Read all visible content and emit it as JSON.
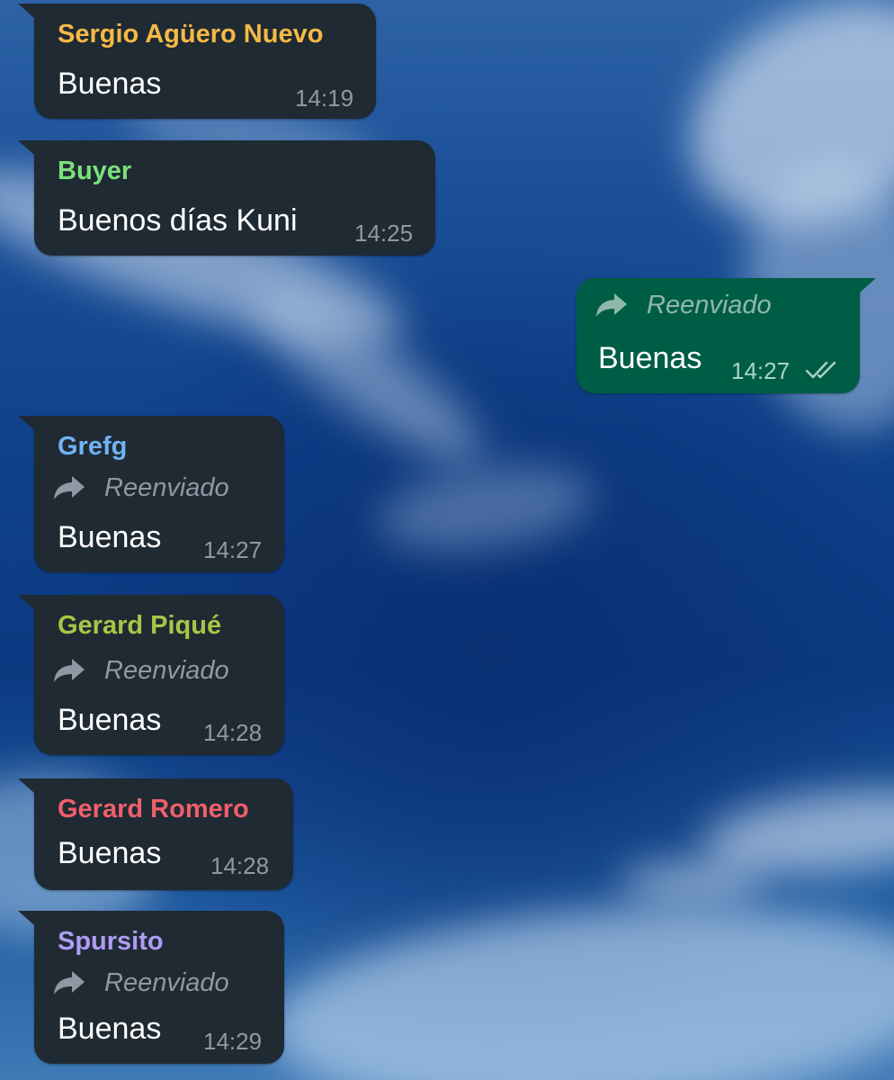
{
  "chat": {
    "messages": [
      {
        "sender": "Sergio Agüero Nuevo",
        "sender_color": "#f5b945",
        "forwarded": false,
        "text": "Buenas",
        "time": "14:19",
        "outgoing": false
      },
      {
        "sender": "Buyer",
        "sender_color": "#7be07c",
        "forwarded": false,
        "text": "Buenos días Kuni",
        "time": "14:25",
        "outgoing": false
      },
      {
        "forward_label": "Reenviado",
        "forwarded": true,
        "text": "Buenas",
        "time": "14:27",
        "outgoing": true,
        "read_receipt": "double-check-icon"
      },
      {
        "sender": "Grefg",
        "sender_color": "#6fb3f2",
        "forwarded": true,
        "forward_label": "Reenviado",
        "text": "Buenas",
        "time": "14:27",
        "outgoing": false
      },
      {
        "sender": "Gerard Piqué",
        "sender_color": "#a8c646",
        "forwarded": true,
        "forward_label": "Reenviado",
        "text": "Buenas",
        "time": "14:28",
        "outgoing": false
      },
      {
        "sender": "Gerard Romero",
        "sender_color": "#ef5f6b",
        "forwarded": false,
        "text": "Buenas",
        "time": "14:28",
        "outgoing": false
      },
      {
        "sender": "Spursito",
        "sender_color": "#b09cf5",
        "forwarded": true,
        "forward_label": "Reenviado",
        "text": "Buenas",
        "time": "14:29",
        "outgoing": false
      }
    ]
  },
  "colors": {
    "incoming_bubble": "#1f2a33",
    "outgoing_bubble": "#005d45",
    "meta_text": "#8e99a3"
  }
}
